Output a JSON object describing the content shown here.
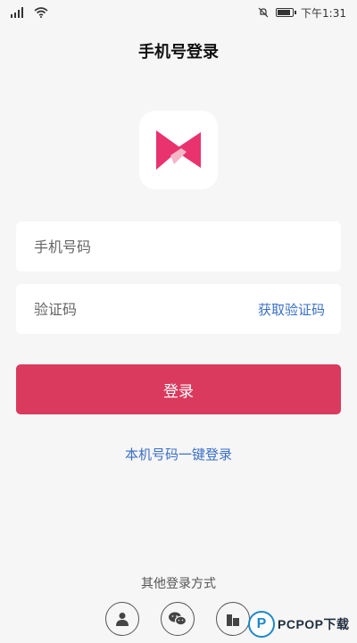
{
  "status_bar": {
    "time": "下午1:31"
  },
  "header": {
    "title": "手机号登录"
  },
  "form": {
    "phone_placeholder": "手机号码",
    "code_placeholder": "验证码",
    "get_code_label": "获取验证码",
    "login_label": "登录"
  },
  "one_click_login": "本机号码一键登录",
  "other_login": {
    "title": "其他登录方式",
    "icons": [
      "user-icon",
      "wechat-icon",
      "building-icon"
    ]
  },
  "watermark": {
    "badge": "P",
    "text": "PCPOP下载"
  },
  "colors": {
    "accent": "#d93a5d",
    "link": "#3a6fc6",
    "logo_pink": "#e8336f",
    "logo_light": "#f5b6c8"
  }
}
